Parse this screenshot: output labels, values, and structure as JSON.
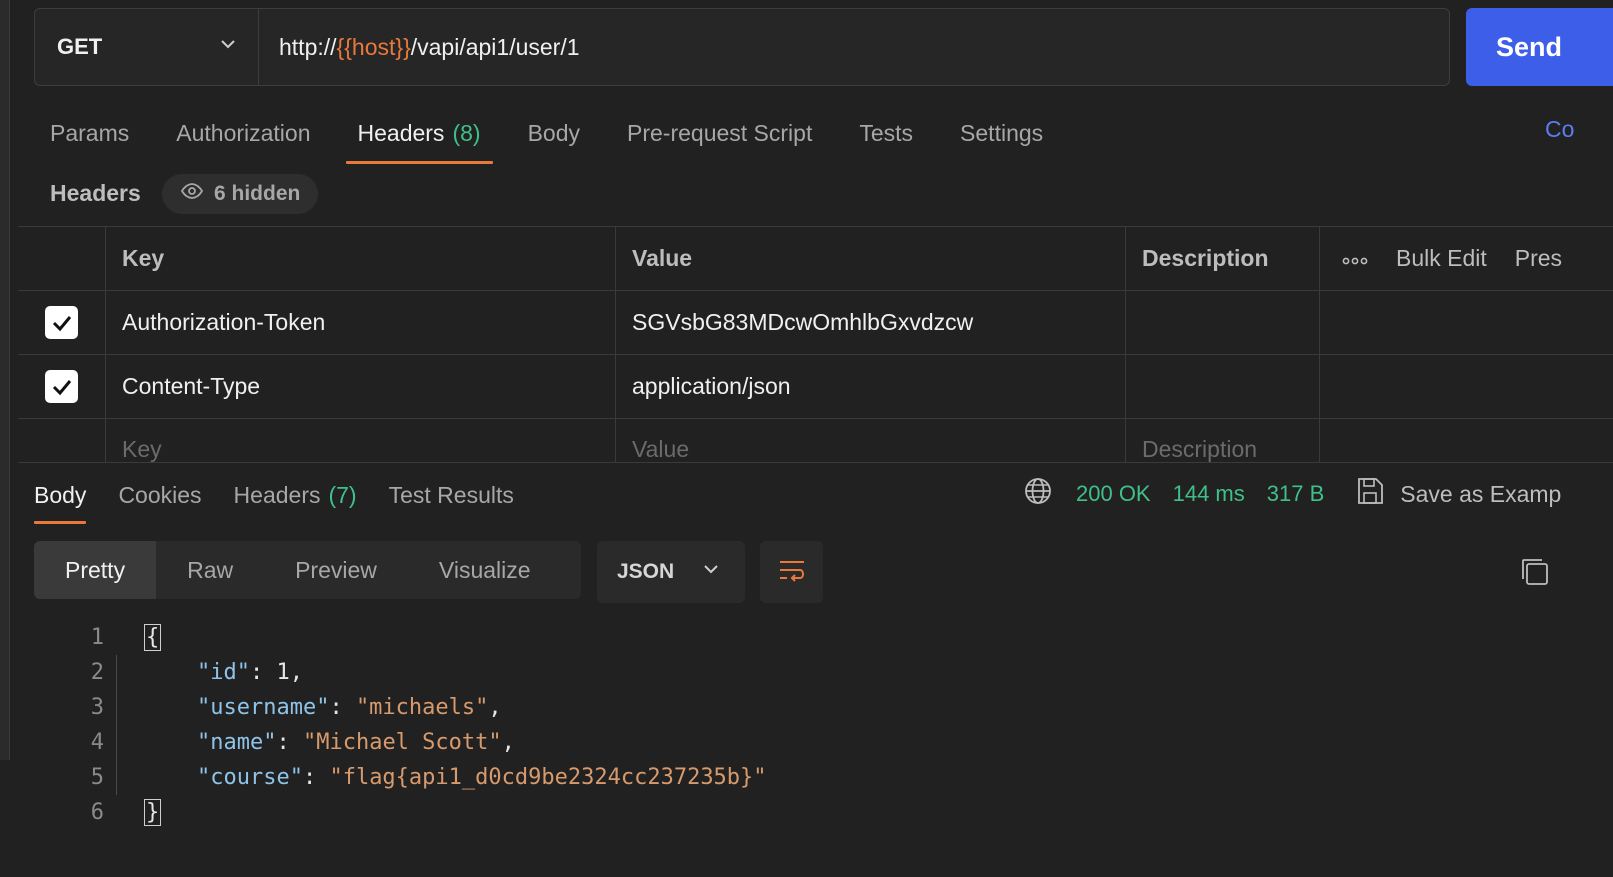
{
  "request": {
    "method": "GET",
    "url_prefix": "http://",
    "url_variable": "{{host}}",
    "url_suffix": "/vapi/api1/user/1",
    "send_label": "Send"
  },
  "request_tabs": [
    {
      "label": "Params"
    },
    {
      "label": "Authorization"
    },
    {
      "label": "Headers",
      "count": "(8)",
      "active": true
    },
    {
      "label": "Body"
    },
    {
      "label": "Pre-request Script"
    },
    {
      "label": "Tests"
    },
    {
      "label": "Settings"
    }
  ],
  "cookies_link": "Co",
  "headers_section": {
    "title": "Headers",
    "hidden_label": "6 hidden"
  },
  "headers_table": {
    "columns": {
      "key": "Key",
      "value": "Value",
      "description": "Description"
    },
    "bulk_edit": "Bulk Edit",
    "presets": "Pres",
    "rows": [
      {
        "key": "Authorization-Token",
        "value": "SGVsbG83MDcwOmhlbGxvdzcw",
        "description": ""
      },
      {
        "key": "Content-Type",
        "value": "application/json",
        "description": ""
      }
    ],
    "placeholders": {
      "key": "Key",
      "value": "Value",
      "description": "Description"
    }
  },
  "response_tabs": [
    {
      "label": "Body",
      "active": true
    },
    {
      "label": "Cookies"
    },
    {
      "label": "Headers",
      "count": "(7)"
    },
    {
      "label": "Test Results"
    }
  ],
  "response_meta": {
    "status": "200 OK",
    "time": "144 ms",
    "size": "317 B",
    "save_label": "Save as Examp"
  },
  "view_modes": [
    {
      "label": "Pretty",
      "active": true
    },
    {
      "label": "Raw"
    },
    {
      "label": "Preview"
    },
    {
      "label": "Visualize"
    }
  ],
  "format": "JSON",
  "code": {
    "line_numbers": [
      "1",
      "2",
      "3",
      "4",
      "5",
      "6"
    ],
    "open": "{",
    "close": "}",
    "entries": [
      {
        "key": "\"id\"",
        "value": "1",
        "type": "number",
        "comma": ","
      },
      {
        "key": "\"username\"",
        "value": "\"michaels\"",
        "type": "string",
        "comma": ","
      },
      {
        "key": "\"name\"",
        "value": "\"Michael Scott\"",
        "type": "string",
        "comma": ","
      },
      {
        "key": "\"course\"",
        "value": "\"flag{api1_d0cd9be2324cc237235b}\"",
        "type": "string",
        "comma": ""
      }
    ]
  },
  "colors": {
    "accent": "#e8793b",
    "send": "#3d5ee8",
    "success": "#3fc08a",
    "json_key": "#8fc3e8",
    "json_string": "#d79a6d"
  }
}
